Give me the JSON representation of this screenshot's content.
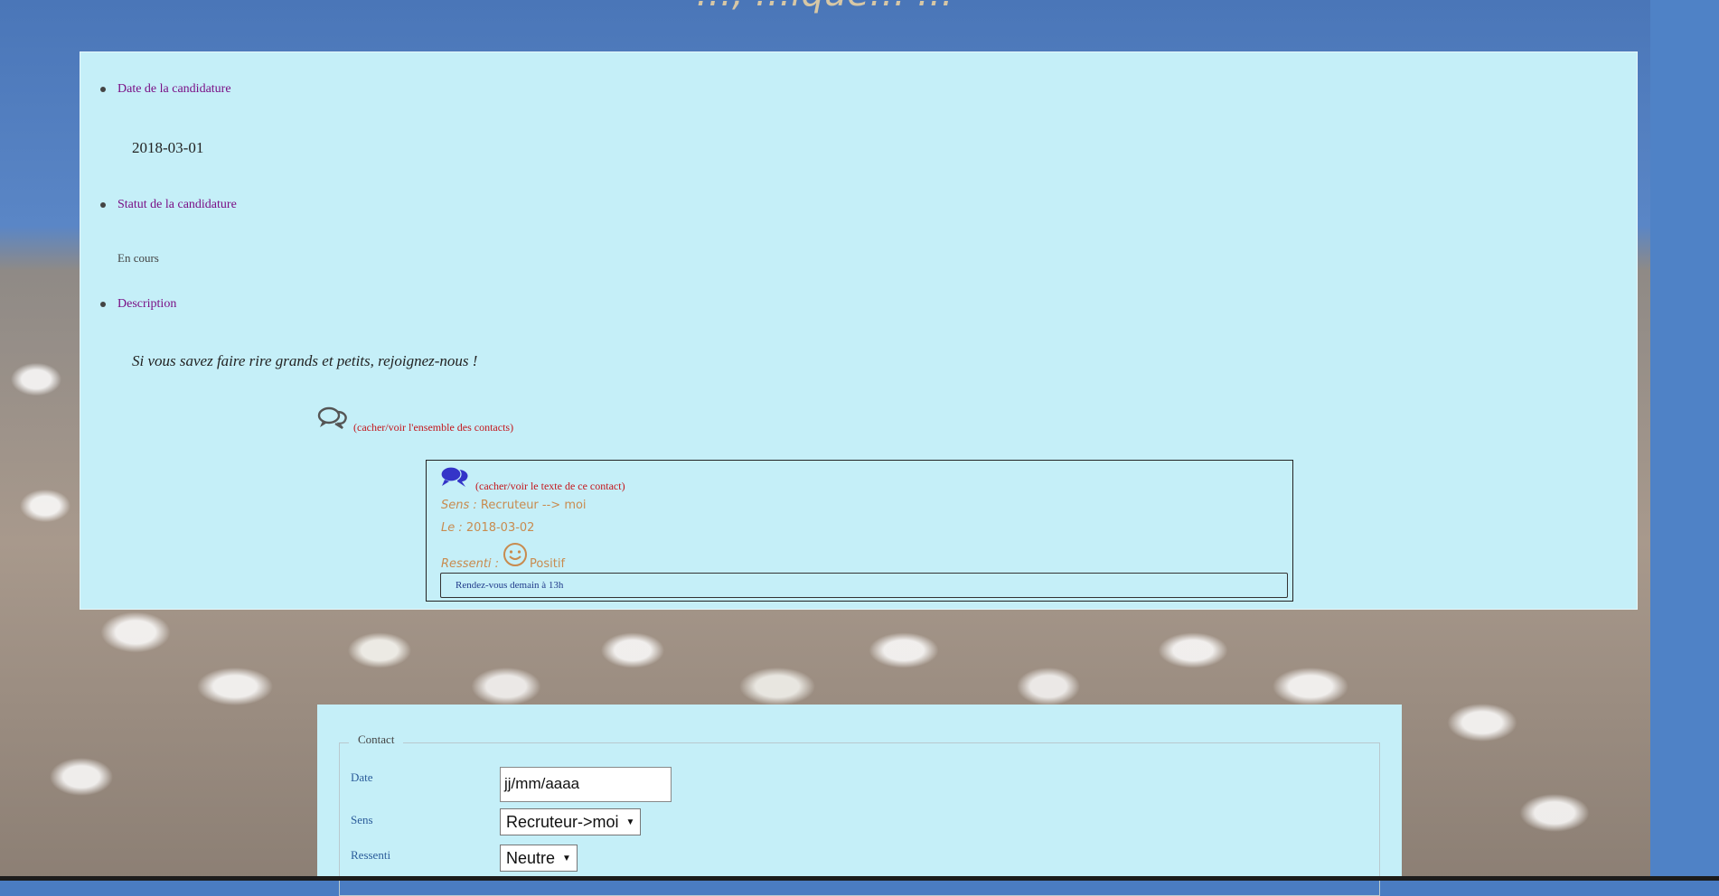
{
  "header": {
    "title_fragment": "…, …ique… …"
  },
  "candidature": {
    "date_label": "Date de la candidature",
    "date_value": "2018-03-01",
    "status_label": "Statut de la candidature",
    "status_value": "En cours",
    "description_label": "Description",
    "description_value": "Si vous savez faire rire grands et petits, rejoignez-nous !",
    "toggle_all_contacts": "(cacher/voir l'ensemble des contacts)"
  },
  "contact": {
    "toggle_text": "(cacher/voir le texte de ce contact)",
    "sens_key": "Sens :",
    "sens_value": "Recruteur --> moi",
    "le_key": "Le :",
    "le_value": "2018-03-02",
    "ressenti_key": "Ressenti :",
    "ressenti_value": "Positif",
    "text": "Rendez-vous demain à 13h"
  },
  "form": {
    "legend": "Contact",
    "date_label": "Date",
    "date_placeholder": "jj/mm/aaaa",
    "sens_label": "Sens",
    "sens_selected": "Recruteur->moi",
    "ressenti_label": "Ressenti",
    "ressenti_selected": "Neutre"
  },
  "colors": {
    "panel_bg": "#c5eff8",
    "label_purple": "#7a0f85",
    "link_red": "#c4161c",
    "contact_orange": "#c88b4f",
    "icon_blue": "#3434c8",
    "icon_gray": "#555555"
  },
  "icons": [
    "speech-bubbles-outline-icon",
    "speech-bubbles-filled-icon",
    "smiley-icon",
    "chevron-down-icon"
  ]
}
